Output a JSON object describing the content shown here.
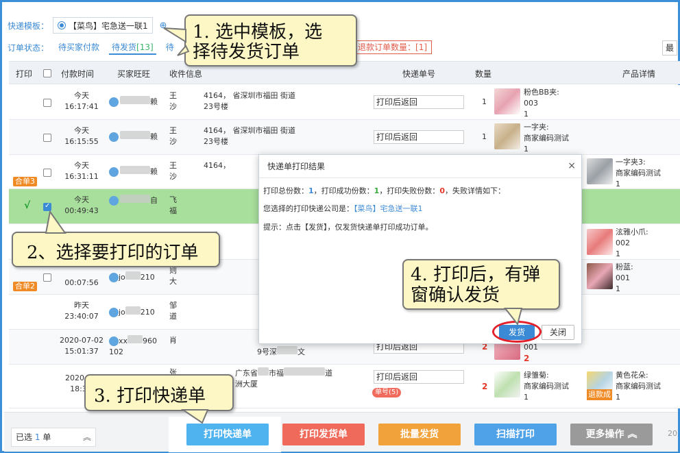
{
  "filters": {
    "template_label": "快递模板：",
    "template_value": "【菜鸟】宅急送一联1",
    "template_add_icon": "⊕",
    "status_label": "订单状态：",
    "status_tabs": [
      "待买家付款",
      "待发货",
      "待"
    ],
    "pending_count": "[13]",
    "refund_label": "退款订单数量：",
    "refund_count": "[1]",
    "sort_label": "最"
  },
  "table": {
    "headers": [
      "打印",
      "付款时间",
      "买家旺旺",
      "收件信息",
      "快递单号",
      "数量",
      "产品详情"
    ],
    "rows": [
      {
        "date": "今天",
        "time": "16:17:41",
        "buyer_tail": "赖",
        "recipient": [
          "王",
          "沙"
        ],
        "addr1": "4164，",
        "addr2": "省深圳市福田",
        "addr3": "街道",
        "addr4": "23号楼",
        "waybill": "打印后返回",
        "qty": "1",
        "prod_name": "粉色BB夹:",
        "prod_code": "003",
        "prod_qty": "1"
      },
      {
        "date": "今天",
        "time": "16:15:55",
        "buyer_tail": "赖",
        "recipient": [
          "王",
          "沙"
        ],
        "addr1": "4164，",
        "addr2": "省深圳市福田",
        "addr3": "街道",
        "addr4": "23号楼",
        "waybill": "打印后返回",
        "qty": "1",
        "prod_name": "一字夹:",
        "prod_code": "商家编码测试",
        "prod_qty": "1"
      },
      {
        "date": "今天",
        "time": "16:31:11",
        "buyer_tail": "赖",
        "recipient": [
          "王",
          "沙"
        ],
        "addr1": "4164，",
        "merge_tag": "合单3",
        "prod_name": "一字夹3:",
        "prod_code": "商家编码测试",
        "prod_qty": "1"
      },
      {
        "check_mark": "√",
        "date": "今天",
        "time": "00:49:43",
        "buyer_tail": "自",
        "recipient": [
          "飞",
          "福"
        ]
      },
      {
        "recipient": [
          "6"
        ],
        "prod_name": "泫雅小爪:",
        "prod_code": "002",
        "prod_qty": "1"
      },
      {
        "time": "00:07:56",
        "buyer": "jo",
        "num": "210",
        "recipient": [
          "则",
          "大"
        ],
        "merge_tag": "合单2",
        "prod_name": "粉蓝:",
        "prod_code": "001",
        "prod_qty": "1"
      },
      {
        "date": "昨天",
        "time": "23:40:07",
        "buyer": "jo",
        "num": "210",
        "recipient": [
          "邹",
          "道"
        ]
      },
      {
        "date": "2020-07-02",
        "time": "15:01:37",
        "buyer": "xx",
        "num": "960",
        "buyer_sub": "102",
        "recipient": [
          "肖"
        ],
        "addr_mid": "9号深",
        "addr_end": "文",
        "waybill": "打印后返回",
        "qty": "2",
        "prod_code": "001",
        "prod_qty": "2"
      },
      {
        "date": "2020-06",
        "time": "18:32",
        "recipient": [
          "张"
        ],
        "addr_mid": "广东省",
        "addr_mid2": "市福",
        "addr_end": "道",
        "addr_line2": "洲大厦",
        "waybill": "打印后返回",
        "waybill_tag": "单号(5)",
        "qty": "2",
        "prod_name": "绿雏菊:",
        "prod_code": "商家编码测试",
        "prod_qty": "1",
        "prod2_name": "黄色花朵:",
        "prod2_code": "商家编码测试",
        "prod2_qty": "1",
        "refund_tag": "退款成"
      }
    ]
  },
  "dialog": {
    "title": "快递单打印结果",
    "close_icon": "×",
    "total_label": "打印总份数：",
    "total": "1",
    "success_label": "，打印成功份数：",
    "success": "1",
    "fail_label": "，打印失败份数：",
    "fail": "0",
    "fail_tail": "，失败详情如下：",
    "company_label": "您选择的打印快递公司是：",
    "company": "【菜鸟】宅急送一联1",
    "tip": "提示：点击【发货】，仅发货快递单打印成功订单。",
    "ship_button": "发货",
    "close_button": "关闭"
  },
  "callouts": {
    "c1_line1": "1. 选中模板，选",
    "c1_line2": "择待发货订单",
    "c2": "2、选择要打印的订单",
    "c3": "3. 打印快递单",
    "c4_line1": "4. 打印后，有弹",
    "c4_line2": "窗确认发货"
  },
  "bottom": {
    "selected_prefix": "已选",
    "selected_count": "1",
    "selected_suffix": "单",
    "collapse_icon": "︽",
    "print_waybill": "打印快递单",
    "print_invoice": "打印发货单",
    "batch_ship": "批量发货",
    "scan_print": "扫描打印",
    "more_ops": "更多操作",
    "more_icon": "︽",
    "page_hint": "20"
  },
  "colors": {
    "accent": "#3b8ad6",
    "selected_row": "#a9df9c",
    "btn_print_waybill": "#4fb3ef",
    "btn_print_invoice": "#ef6a5a",
    "btn_batch_ship": "#f2a23b",
    "btn_scan_print": "#4fa2e8",
    "btn_more": "#9a9a9a"
  }
}
